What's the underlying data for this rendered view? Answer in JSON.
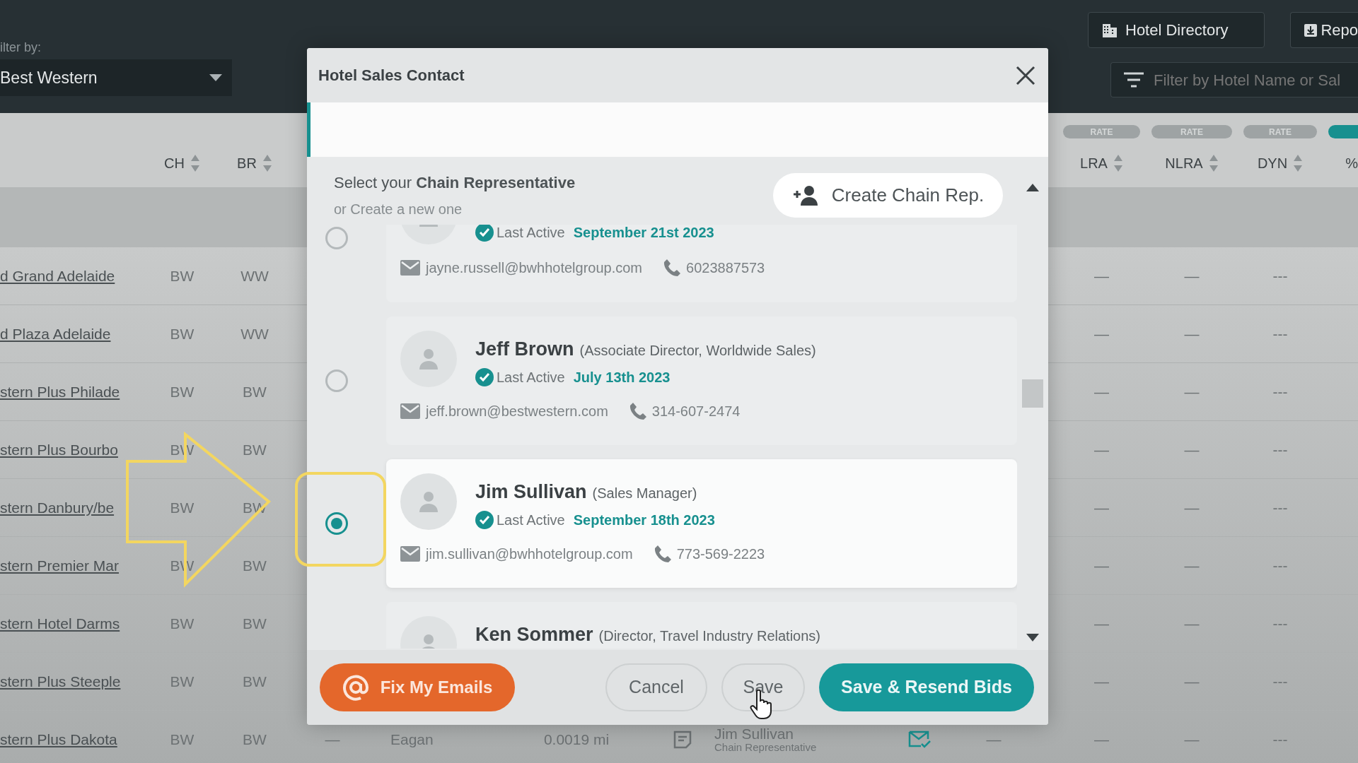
{
  "toolbar": {
    "filter_label": "ilter by:",
    "chain_select": "Best Western",
    "buttons": [
      {
        "kind": "directory",
        "label": "Hotel Directory"
      },
      {
        "kind": "report",
        "label": "Repo"
      }
    ],
    "search": {
      "placeholder": "Filter by Hotel Name or Sal"
    }
  },
  "table": {
    "rate_pills": [
      {
        "label": "RATE",
        "active": false
      },
      {
        "label": "RATE",
        "active": false
      },
      {
        "label": "RATE",
        "active": false
      },
      {
        "active": true
      }
    ],
    "columns": [
      {
        "label": "CH",
        "sortable": true
      },
      {
        "label": "BR",
        "sortable": true
      },
      {
        "label": "LRA",
        "sortable": true
      },
      {
        "label": "NLRA",
        "sortable": true
      },
      {
        "label": "DYN",
        "sortable": true
      },
      {
        "label": "%",
        "sortable": false
      }
    ],
    "rows": [
      {
        "name": "d Grand Adelaide",
        "ch": "BW",
        "br": "WW",
        "lra": "—",
        "nlra": "—",
        "dyn": "---"
      },
      {
        "name": "d Plaza Adelaide",
        "ch": "BW",
        "br": "WW",
        "lra": "—",
        "nlra": "—",
        "dyn": "---"
      },
      {
        "name": "stern Plus Philade",
        "ch": "BW",
        "br": "BW",
        "lra": "—",
        "nlra": "—",
        "dyn": "---"
      },
      {
        "name": "stern Plus Bourbo",
        "ch": "BW",
        "br": "BW",
        "lra": "—",
        "nlra": "—",
        "dyn": "---"
      },
      {
        "name": "stern Danbury/be",
        "ch": "BW",
        "br": "BW",
        "lra": "—",
        "nlra": "—",
        "dyn": "---"
      },
      {
        "name": "stern Premier Mar",
        "ch": "BW",
        "br": "BW",
        "lra": "—",
        "nlra": "—",
        "dyn": "---"
      },
      {
        "name": "stern Hotel Darms",
        "ch": "BW",
        "br": "BW",
        "lra": "—",
        "nlra": "—",
        "dyn": "---"
      },
      {
        "name": "stern Plus Steeple",
        "ch": "BW",
        "br": "BW",
        "lra": "—",
        "nlra": "—",
        "dyn": "---"
      },
      {
        "name": "stern Plus Dakota",
        "ch": "BW",
        "br": "BW",
        "lra": "—",
        "nlra": "—",
        "dyn": "---",
        "details": {
          "column_4": "—",
          "city": "Eagan",
          "distance": "0.0019 mi",
          "note": true,
          "contact_name": "Jim Sullivan",
          "contact_role": "Chain Representative",
          "mail": true,
          "column_10": "—"
        }
      }
    ]
  },
  "modal": {
    "title": "Hotel Sales Contact",
    "intro": "Select your **Chain Representative**",
    "intro_sub": "or Create a new one",
    "create_button": "Create Chain Rep.",
    "contacts": [
      {
        "selected": false,
        "last_active_label": "Last Active",
        "last_active": "September 21st 2023",
        "email": "jayne.russell@bwhhotelgroup.com",
        "phone": "6023887573"
      },
      {
        "selected": false,
        "name": "Jeff Brown",
        "title": "(Associate Director, Worldwide Sales)",
        "last_active_label": "Last Active",
        "last_active": "July 13th 2023",
        "email": "jeff.brown@bestwestern.com",
        "phone": "314-607-2474"
      },
      {
        "selected": true,
        "name": "Jim Sullivan",
        "title": "(Sales Manager)",
        "last_active_label": "Last Active",
        "last_active": "September 18th 2023",
        "email": "jim.sullivan@bwhhotelgroup.com",
        "phone": "773-569-2223"
      },
      {
        "selected": false,
        "name": "Ken Sommer",
        "title": "(Director, Travel Industry Relations)"
      }
    ],
    "footer": {
      "fix_button": "Fix My Emails",
      "cancel_button": "Cancel",
      "save_button": "Save",
      "resend_button": "Save & Resend Bids"
    }
  }
}
